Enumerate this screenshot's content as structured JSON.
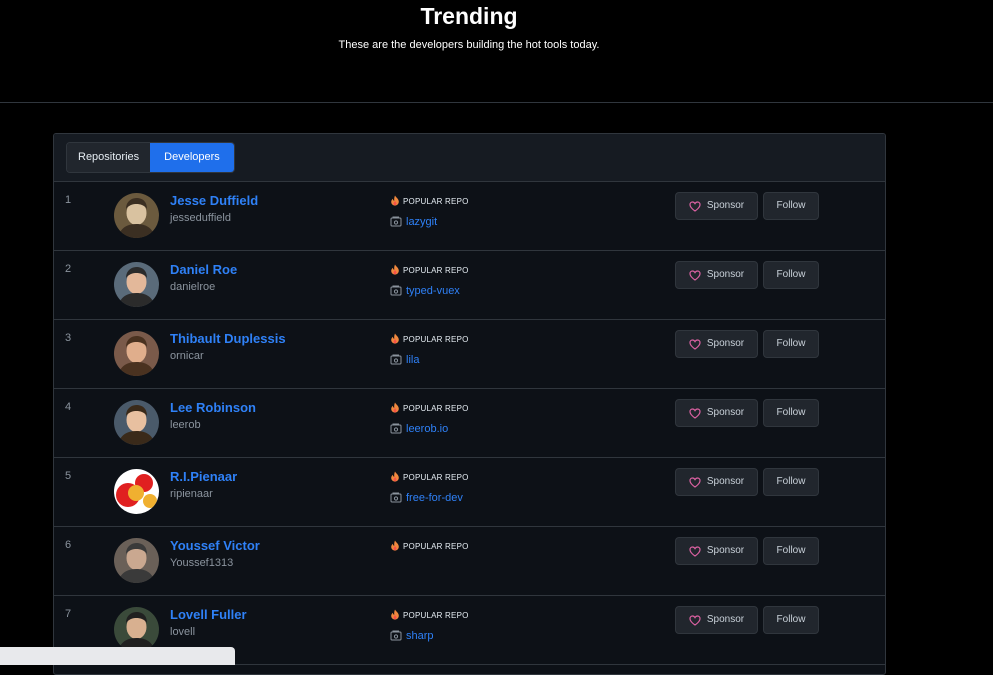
{
  "header": {
    "title": "Trending",
    "subtitle": "These are the developers building the hot tools today."
  },
  "tabs": [
    {
      "label": "Repositories",
      "active": false
    },
    {
      "label": "Developers",
      "active": true
    }
  ],
  "labels": {
    "popular_repo": "POPULAR REPO",
    "sponsor": "Sponsor",
    "follow": "Follow"
  },
  "colors": {
    "accent": "#2f81f7",
    "active_tab": "#1f6feb",
    "sponsor_heart": "#db61a2"
  },
  "developers": [
    {
      "rank": "1",
      "name": "Jesse Duffield",
      "login": "jesseduffield",
      "repo": "lazygit"
    },
    {
      "rank": "2",
      "name": "Daniel Roe",
      "login": "danielroe",
      "repo": "typed-vuex"
    },
    {
      "rank": "3",
      "name": "Thibault Duplessis",
      "login": "ornicar",
      "repo": "lila"
    },
    {
      "rank": "4",
      "name": "Lee Robinson",
      "login": "leerob",
      "repo": "leerob.io"
    },
    {
      "rank": "5",
      "name": "R.I.Pienaar",
      "login": "ripienaar",
      "repo": "free-for-dev"
    },
    {
      "rank": "6",
      "name": "Youssef Victor",
      "login": "Youssef1313",
      "repo": ""
    },
    {
      "rank": "7",
      "name": "Lovell Fuller",
      "login": "lovell",
      "repo": "sharp"
    }
  ]
}
